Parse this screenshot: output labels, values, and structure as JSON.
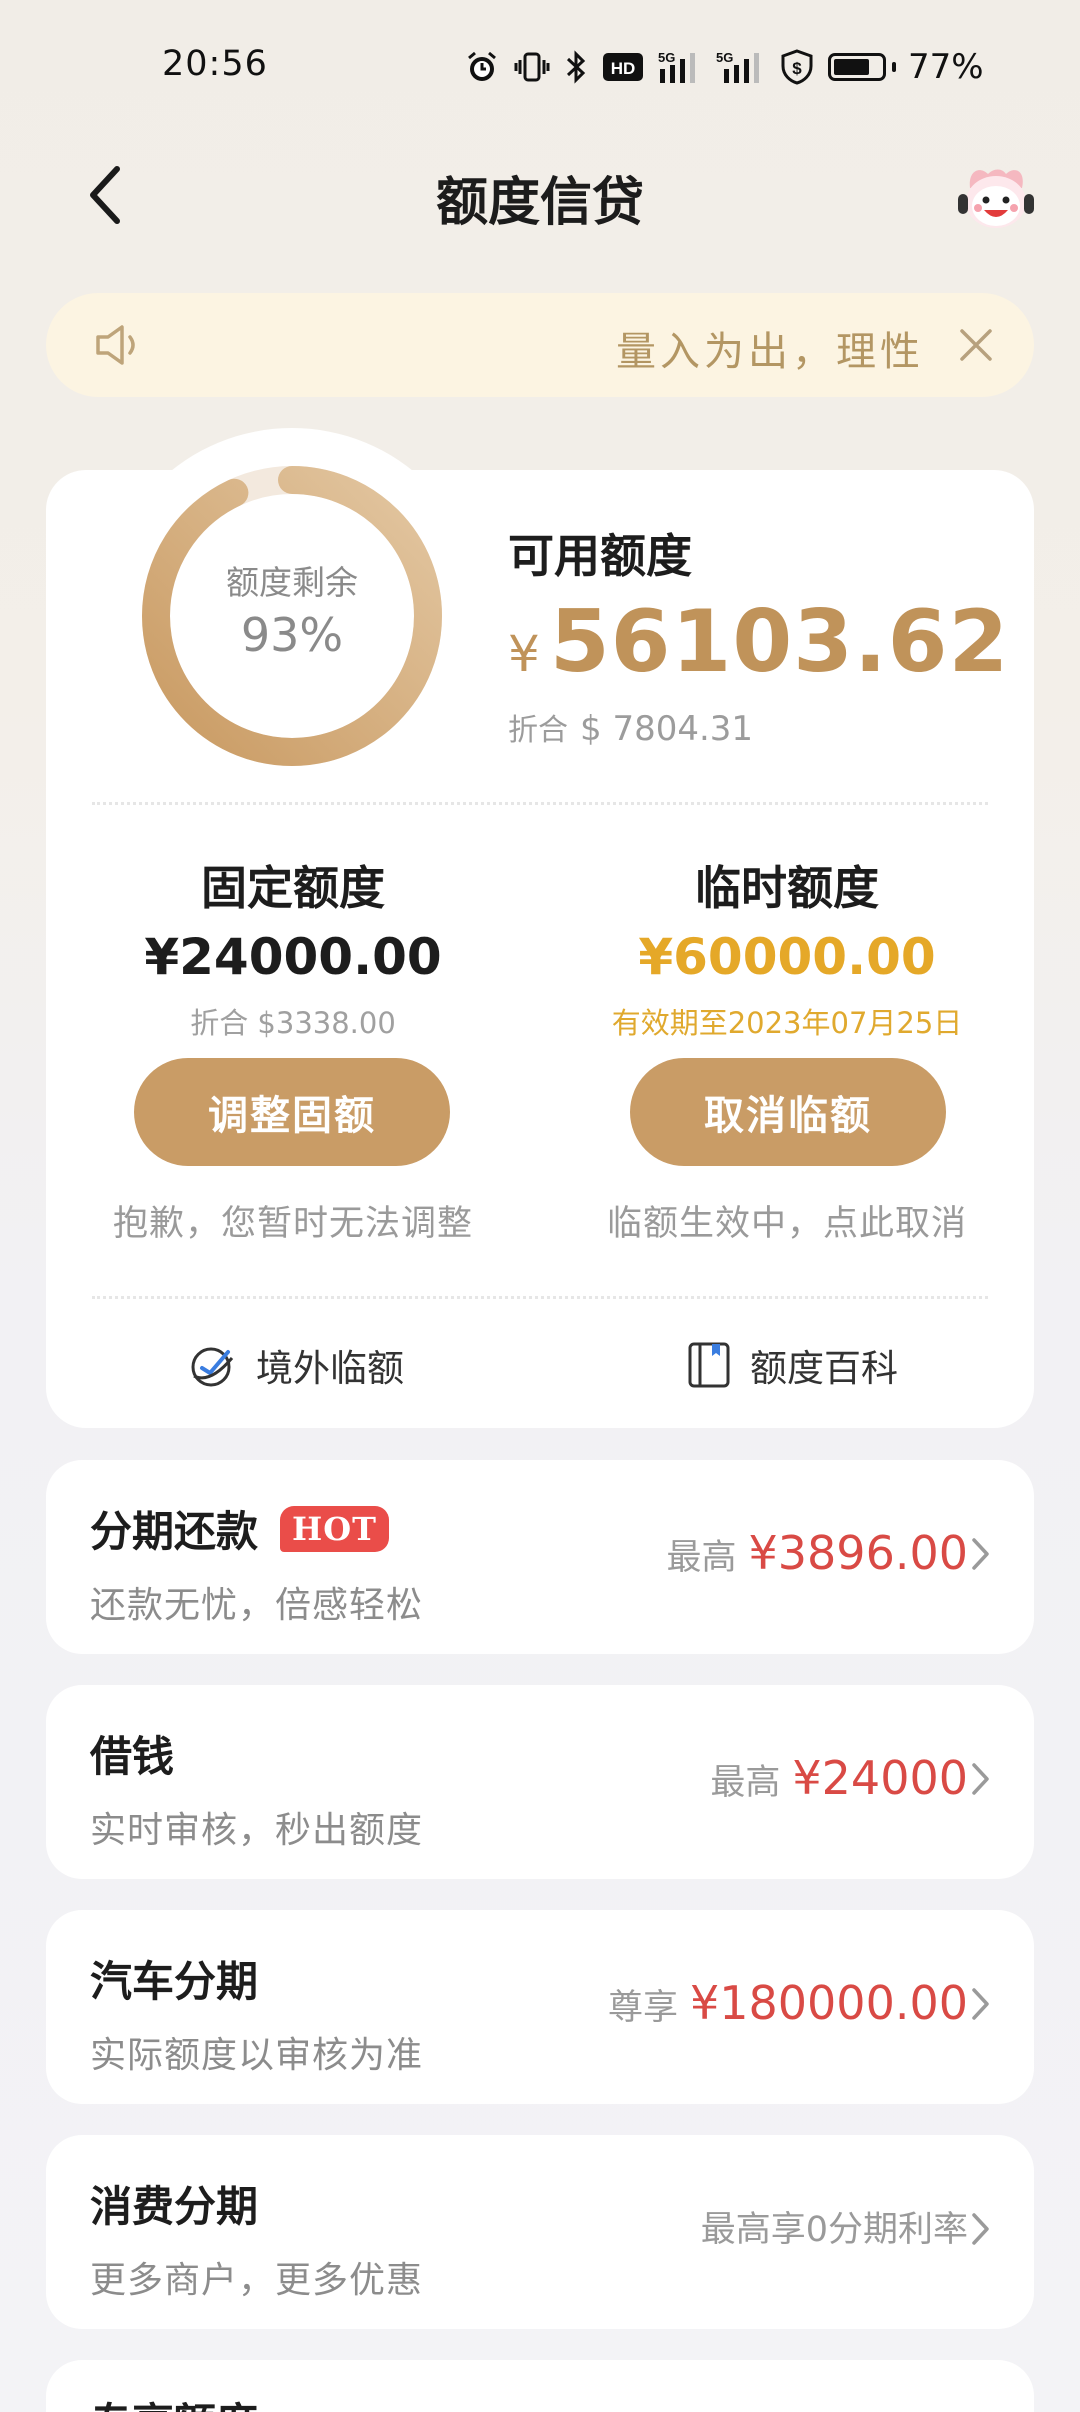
{
  "status_bar": {
    "time": "20:56",
    "battery_percent": "77%",
    "battery_level": 0.77,
    "icons": [
      "alarm-icon",
      "vibrate-icon",
      "bluetooth-icon",
      "hd-icon",
      "signal-5g-icon",
      "signal-5g-icon",
      "shield-dollar-icon",
      "battery-icon"
    ],
    "hd_label": "HD",
    "net_label": "5G"
  },
  "nav": {
    "title": "额度信贷",
    "back_icon": "chevron-left-icon",
    "assistant_icon": "mascot-icon"
  },
  "notice": {
    "text": "量入为出，理性",
    "speaker_icon": "speaker-icon",
    "close_icon": "close-icon"
  },
  "credit": {
    "ring_label": "额度剩余",
    "ring_value": "93%",
    "ring_fraction": 0.93,
    "available_title": "可用额度",
    "currency": "¥",
    "available_amount": "56103.62",
    "convert_label": "折合",
    "convert_amount": "$ 7804.31",
    "fixed": {
      "title": "固定额度",
      "amount": "¥24000.00",
      "sub": "折合 $3338.00",
      "button": "调整固额",
      "note": "抱歉，您暂时无法调整"
    },
    "temporary": {
      "title": "临时额度",
      "amount": "¥60000.00",
      "sub": "有效期至2023年07月25日",
      "button": "取消临额",
      "note": "临额生效中，点此取消"
    },
    "links": [
      {
        "label": "境外临额",
        "icon": "globe-plane-icon"
      },
      {
        "label": "额度百科",
        "icon": "book-icon"
      }
    ]
  },
  "products": [
    {
      "title": "分期还款",
      "badge": "HOT",
      "sub": "还款无忧，倍感轻松",
      "prefix": "最高",
      "value": "¥3896.00"
    },
    {
      "title": "借钱",
      "badge": "",
      "sub": "实时审核，秒出额度",
      "prefix": "最高",
      "value": "¥24000"
    },
    {
      "title": "汽车分期",
      "badge": "",
      "sub": "实际额度以审核为准",
      "prefix": "尊享",
      "value": "¥180000.00"
    },
    {
      "title": "消费分期",
      "badge": "",
      "sub": "更多商户，更多优惠",
      "prefix": "最高享0分期利率",
      "value": ""
    },
    {
      "title": "专享额度",
      "badge": "",
      "sub": "",
      "prefix": "",
      "value": ""
    }
  ],
  "colors": {
    "accent_gold": "#c99c66",
    "temp_gold": "#e5a828",
    "price_red": "#d94a45",
    "notice_bg": "#fcf4e2"
  }
}
